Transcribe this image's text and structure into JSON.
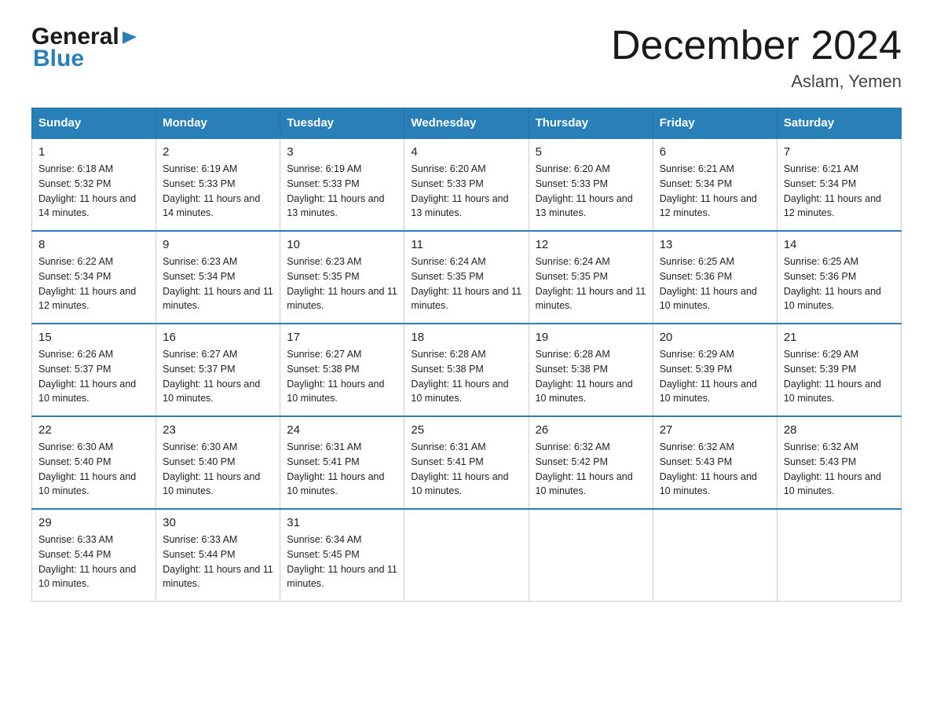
{
  "logo": {
    "general": "General",
    "triangle": "▶",
    "blue": "Blue"
  },
  "header": {
    "month_year": "December 2024",
    "location": "Aslam, Yemen"
  },
  "days_of_week": [
    "Sunday",
    "Monday",
    "Tuesday",
    "Wednesday",
    "Thursday",
    "Friday",
    "Saturday"
  ],
  "weeks": [
    [
      {
        "day": "1",
        "sunrise": "6:18 AM",
        "sunset": "5:32 PM",
        "daylight": "11 hours and 14 minutes."
      },
      {
        "day": "2",
        "sunrise": "6:19 AM",
        "sunset": "5:33 PM",
        "daylight": "11 hours and 14 minutes."
      },
      {
        "day": "3",
        "sunrise": "6:19 AM",
        "sunset": "5:33 PM",
        "daylight": "11 hours and 13 minutes."
      },
      {
        "day": "4",
        "sunrise": "6:20 AM",
        "sunset": "5:33 PM",
        "daylight": "11 hours and 13 minutes."
      },
      {
        "day": "5",
        "sunrise": "6:20 AM",
        "sunset": "5:33 PM",
        "daylight": "11 hours and 13 minutes."
      },
      {
        "day": "6",
        "sunrise": "6:21 AM",
        "sunset": "5:34 PM",
        "daylight": "11 hours and 12 minutes."
      },
      {
        "day": "7",
        "sunrise": "6:21 AM",
        "sunset": "5:34 PM",
        "daylight": "11 hours and 12 minutes."
      }
    ],
    [
      {
        "day": "8",
        "sunrise": "6:22 AM",
        "sunset": "5:34 PM",
        "daylight": "11 hours and 12 minutes."
      },
      {
        "day": "9",
        "sunrise": "6:23 AM",
        "sunset": "5:34 PM",
        "daylight": "11 hours and 11 minutes."
      },
      {
        "day": "10",
        "sunrise": "6:23 AM",
        "sunset": "5:35 PM",
        "daylight": "11 hours and 11 minutes."
      },
      {
        "day": "11",
        "sunrise": "6:24 AM",
        "sunset": "5:35 PM",
        "daylight": "11 hours and 11 minutes."
      },
      {
        "day": "12",
        "sunrise": "6:24 AM",
        "sunset": "5:35 PM",
        "daylight": "11 hours and 11 minutes."
      },
      {
        "day": "13",
        "sunrise": "6:25 AM",
        "sunset": "5:36 PM",
        "daylight": "11 hours and 10 minutes."
      },
      {
        "day": "14",
        "sunrise": "6:25 AM",
        "sunset": "5:36 PM",
        "daylight": "11 hours and 10 minutes."
      }
    ],
    [
      {
        "day": "15",
        "sunrise": "6:26 AM",
        "sunset": "5:37 PM",
        "daylight": "11 hours and 10 minutes."
      },
      {
        "day": "16",
        "sunrise": "6:27 AM",
        "sunset": "5:37 PM",
        "daylight": "11 hours and 10 minutes."
      },
      {
        "day": "17",
        "sunrise": "6:27 AM",
        "sunset": "5:38 PM",
        "daylight": "11 hours and 10 minutes."
      },
      {
        "day": "18",
        "sunrise": "6:28 AM",
        "sunset": "5:38 PM",
        "daylight": "11 hours and 10 minutes."
      },
      {
        "day": "19",
        "sunrise": "6:28 AM",
        "sunset": "5:38 PM",
        "daylight": "11 hours and 10 minutes."
      },
      {
        "day": "20",
        "sunrise": "6:29 AM",
        "sunset": "5:39 PM",
        "daylight": "11 hours and 10 minutes."
      },
      {
        "day": "21",
        "sunrise": "6:29 AM",
        "sunset": "5:39 PM",
        "daylight": "11 hours and 10 minutes."
      }
    ],
    [
      {
        "day": "22",
        "sunrise": "6:30 AM",
        "sunset": "5:40 PM",
        "daylight": "11 hours and 10 minutes."
      },
      {
        "day": "23",
        "sunrise": "6:30 AM",
        "sunset": "5:40 PM",
        "daylight": "11 hours and 10 minutes."
      },
      {
        "day": "24",
        "sunrise": "6:31 AM",
        "sunset": "5:41 PM",
        "daylight": "11 hours and 10 minutes."
      },
      {
        "day": "25",
        "sunrise": "6:31 AM",
        "sunset": "5:41 PM",
        "daylight": "11 hours and 10 minutes."
      },
      {
        "day": "26",
        "sunrise": "6:32 AM",
        "sunset": "5:42 PM",
        "daylight": "11 hours and 10 minutes."
      },
      {
        "day": "27",
        "sunrise": "6:32 AM",
        "sunset": "5:43 PM",
        "daylight": "11 hours and 10 minutes."
      },
      {
        "day": "28",
        "sunrise": "6:32 AM",
        "sunset": "5:43 PM",
        "daylight": "11 hours and 10 minutes."
      }
    ],
    [
      {
        "day": "29",
        "sunrise": "6:33 AM",
        "sunset": "5:44 PM",
        "daylight": "11 hours and 10 minutes."
      },
      {
        "day": "30",
        "sunrise": "6:33 AM",
        "sunset": "5:44 PM",
        "daylight": "11 hours and 11 minutes."
      },
      {
        "day": "31",
        "sunrise": "6:34 AM",
        "sunset": "5:45 PM",
        "daylight": "11 hours and 11 minutes."
      },
      null,
      null,
      null,
      null
    ]
  ],
  "labels": {
    "sunrise": "Sunrise:",
    "sunset": "Sunset:",
    "daylight": "Daylight:"
  }
}
